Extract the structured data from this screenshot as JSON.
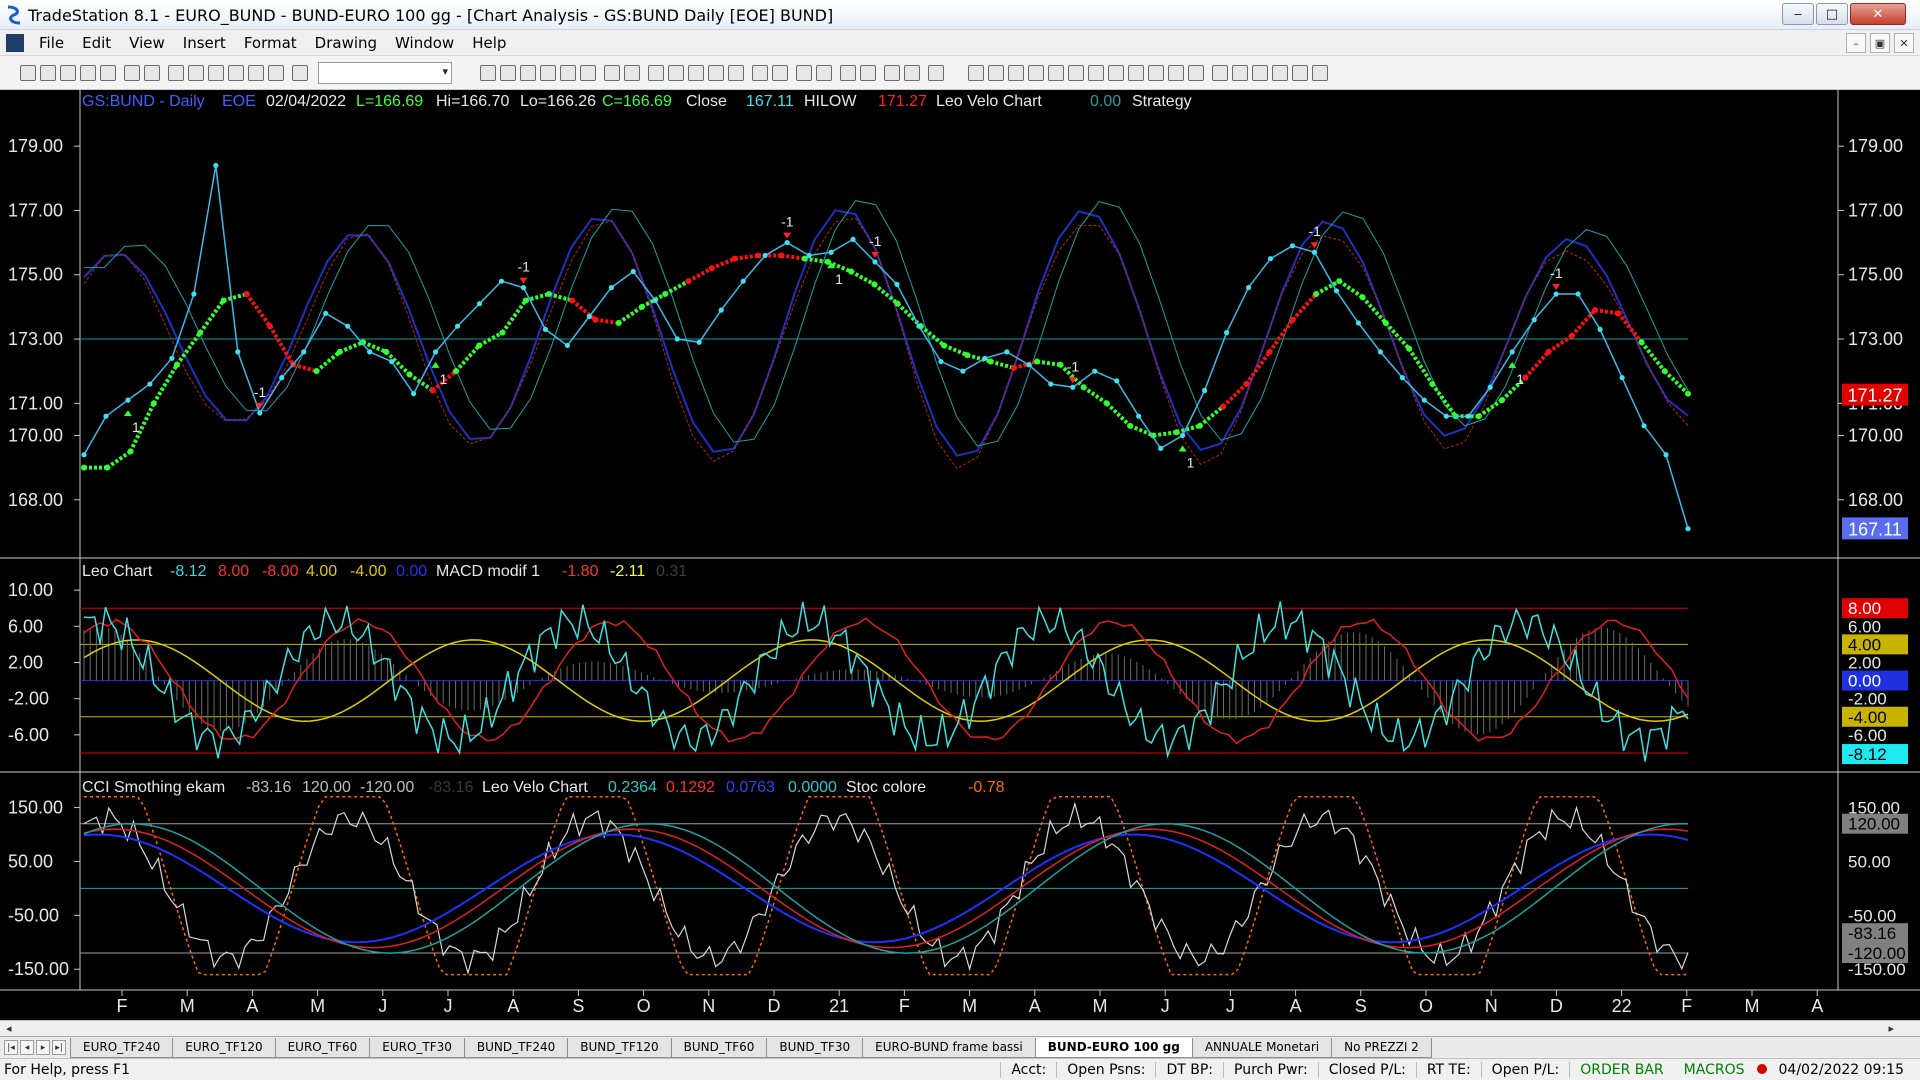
{
  "window": {
    "title": "TradeStation 8.1 - EURO_BUND - BUND-EURO 100 gg - [Chart Analysis - GS:BUND  Daily  [EOE] BUND]",
    "min": "‒",
    "max": "□",
    "close": "✕"
  },
  "menu": {
    "items": [
      "File",
      "Edit",
      "View",
      "Insert",
      "Format",
      "Drawing",
      "Window",
      "Help"
    ],
    "mdi": [
      "–",
      "▣",
      "✕"
    ]
  },
  "toolbar": {
    "combo_arrow": "▾"
  },
  "price_panel": {
    "symbol": "GS:BUND - Daily",
    "exchange": "EOE",
    "date": "02/04/2022",
    "open": "L=166.69",
    "high": "Hi=166.70",
    "low": "Lo=166.26",
    "close": "C=166.69",
    "close_label": "Close",
    "close_value": "167.11",
    "hilow_label": "HILOW",
    "hilow_value": "171.27",
    "velo_label": "Leo Velo Chart",
    "velo_value": "0.00",
    "strategy": "Strategy",
    "y_labels": [
      "179.00",
      "177.00",
      "175.00",
      "173.00",
      "171.00",
      "170.00",
      "168.00"
    ],
    "right_tags": [
      {
        "text": "171.27",
        "color": "#e00000"
      },
      {
        "text": "167.11",
        "color": "#5a6cf0"
      }
    ],
    "signal_up": "1",
    "signal_down": "-1"
  },
  "macd_panel": {
    "name": "Leo Chart",
    "values": [
      {
        "text": "-8.12",
        "color": "#3fd8e8"
      },
      {
        "text": "8.00",
        "color": "#ff3030"
      },
      {
        "text": "-8.00",
        "color": "#ff3030"
      },
      {
        "text": "4.00",
        "color": "#e0c800"
      },
      {
        "text": "-4.00",
        "color": "#e0c800"
      },
      {
        "text": "0.00",
        "color": "#2030ff"
      }
    ],
    "name2": "MACD modif 1",
    "values2": [
      {
        "text": "-1.80",
        "color": "#ff3030"
      },
      {
        "text": "-2.11",
        "color": "#ffff40"
      },
      {
        "text": "0.31",
        "color": "#404040"
      }
    ],
    "y_labels": [
      "10.00",
      "6.00",
      "2.00",
      "-2.00",
      "-6.00"
    ],
    "right_tags": [
      {
        "text": "8.00",
        "color": "#e00000"
      },
      {
        "text": "6.00",
        "color": ""
      },
      {
        "text": "4.00",
        "color": "#c8b400"
      },
      {
        "text": "2.00",
        "color": ""
      },
      {
        "text": "0.00",
        "color": "#2030e0"
      },
      {
        "text": "-2.00",
        "color": ""
      },
      {
        "text": "-4.00",
        "color": "#c8b400"
      },
      {
        "text": "-6.00",
        "color": ""
      },
      {
        "text": "-8.12",
        "color": "#20e8f0"
      }
    ]
  },
  "cci_panel": {
    "name": "CCI Smothing ekam",
    "values": [
      {
        "text": "-83.16",
        "color": "#c0c0c0"
      },
      {
        "text": "120.00",
        "color": "#c0c0c0"
      },
      {
        "text": "-120.00",
        "color": "#c0c0c0"
      },
      {
        "text": "-83.16",
        "color": "#3a3a3a"
      }
    ],
    "name2": "Leo Velo Chart",
    "values2": [
      {
        "text": "0.2364",
        "color": "#30c8c8"
      },
      {
        "text": "0.1292",
        "color": "#ff3030"
      },
      {
        "text": "0.0763",
        "color": "#3040ff"
      },
      {
        "text": "0.0000",
        "color": "#30c8c8"
      }
    ],
    "name3": "Stoc colore",
    "value3": {
      "text": "-0.78",
      "color": "#ff6a00"
    },
    "y_labels": [
      "150.00",
      "50.00",
      "-50.00",
      "-150.00"
    ],
    "right_tags": [
      {
        "text": "150.00",
        "color": ""
      },
      {
        "text": "120.00",
        "color": "#808080"
      },
      {
        "text": "50.00",
        "color": ""
      },
      {
        "text": "-50.00",
        "color": ""
      },
      {
        "text": "-83.16",
        "color": "#808080"
      },
      {
        "text": "-120.00",
        "color": "#808080"
      },
      {
        "text": "-150.00",
        "color": ""
      }
    ]
  },
  "x_axis": [
    "F",
    "M",
    "A",
    "M",
    "J",
    "J",
    "A",
    "S",
    "O",
    "N",
    "D",
    "21",
    "F",
    "M",
    "A",
    "M",
    "J",
    "J",
    "A",
    "S",
    "O",
    "N",
    "D",
    "22",
    "F",
    "M",
    "A"
  ],
  "scroll": {
    "left": "◂",
    "right": "▸"
  },
  "tabs": {
    "nav": [
      "|◂",
      "◂",
      "▸",
      "▸|"
    ],
    "items": [
      "EURO_TF240",
      "EURO_TF120",
      "EURO_TF60",
      "EURO_TF30",
      "BUND_TF240",
      "BUND_TF120",
      "BUND_TF60",
      "BUND_TF30",
      "EURO-BUND frame bassi",
      "BUND-EURO 100 gg",
      "ANNUALE Monetari",
      "No PREZZI 2"
    ],
    "active": 9
  },
  "status": {
    "help": "For Help, press F1",
    "acct": "Acct:",
    "open_psns": "Open Psns:",
    "dt_bp": "DT BP:",
    "purch_pwr": "Purch Pwr:",
    "closed_pl": "Closed P/L:",
    "rt_te": "RT TE:",
    "open_pl": "Open P/L:",
    "order_bar": "ORDER BAR",
    "macros": "MACROS",
    "datetime": "04/02/2022 09:15"
  },
  "colors": {
    "price_dots": "#40e0f0",
    "hilow_up": "#30ff30",
    "hilow_down": "#ff1010",
    "hline": "#00a0a0"
  },
  "chart_data": [
    {
      "type": "line",
      "title": "GS:BUND - Daily",
      "series": [
        {
          "name": "Close",
          "values": [
            169.4,
            170.6,
            171.1,
            171.6,
            172.4,
            174.4,
            178.4,
            172.6,
            170.7,
            171.8,
            172.6,
            173.8,
            173.4,
            172.6,
            172.3,
            171.3,
            172.6,
            173.4,
            174.1,
            174.8,
            174.6,
            173.3,
            172.8,
            173.7,
            174.6,
            175.1,
            174.2,
            173.0,
            172.9,
            173.9,
            174.8,
            175.6,
            176.0,
            175.6,
            175.7,
            176.1,
            175.4,
            174.7,
            173.4,
            172.3,
            172.0,
            172.4,
            172.6,
            172.2,
            171.6,
            171.5,
            172.0,
            171.7,
            170.6,
            169.6,
            170.0,
            171.4,
            173.2,
            174.6,
            175.5,
            175.9,
            175.7,
            174.5,
            173.5,
            172.6,
            171.8,
            171.1,
            170.6,
            170.6,
            171.5,
            172.6,
            173.6,
            174.4,
            174.4,
            173.3,
            171.8,
            170.3,
            169.4,
            167.1
          ]
        },
        {
          "name": "HILOW",
          "values": [
            169.0,
            169.0,
            169.5,
            171.0,
            172.2,
            173.2,
            174.2,
            174.4,
            173.4,
            172.2,
            172.0,
            172.6,
            172.9,
            172.6,
            171.9,
            171.4,
            172.0,
            172.8,
            173.2,
            174.2,
            174.4,
            174.2,
            173.6,
            173.5,
            174.0,
            174.4,
            174.8,
            175.2,
            175.5,
            175.6,
            175.6,
            175.5,
            175.4,
            175.1,
            174.7,
            174.1,
            173.4,
            172.8,
            172.5,
            172.3,
            172.1,
            172.3,
            172.2,
            171.5,
            171.0,
            170.3,
            170.0,
            170.1,
            170.3,
            170.9,
            171.6,
            172.6,
            173.6,
            174.4,
            174.8,
            174.3,
            173.5,
            172.7,
            171.6,
            170.6,
            170.6,
            171.1,
            171.8,
            172.6,
            173.1,
            173.9,
            173.8,
            172.9,
            172.0,
            171.3
          ]
        }
      ],
      "ylim": [
        166.5,
        180
      ]
    },
    {
      "type": "line",
      "title": "Leo Chart / MACD modif 1",
      "ylim": [
        -9,
        12
      ]
    },
    {
      "type": "line",
      "title": "CCI Smothing ekam / Leo Velo Chart / Stoc colore",
      "ylim": [
        -170,
        190
      ]
    }
  ]
}
